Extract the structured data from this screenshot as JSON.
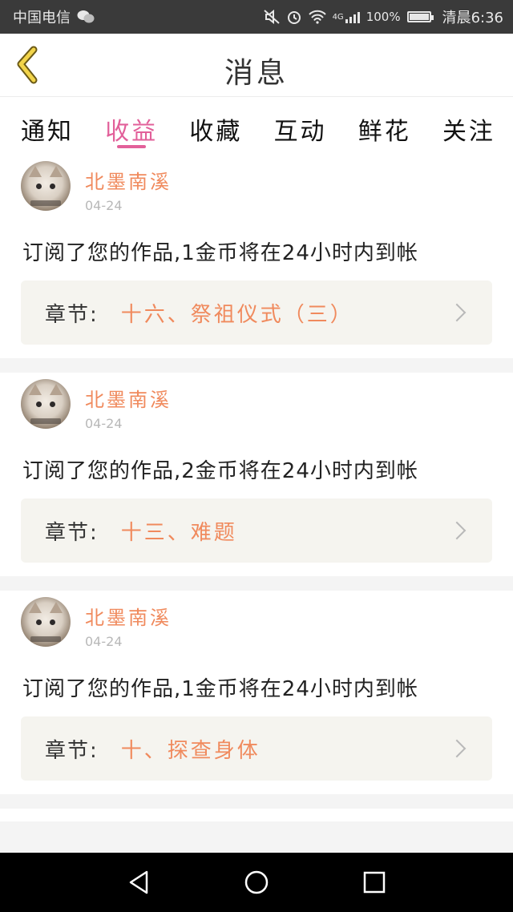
{
  "status_bar": {
    "carrier": "中国电信",
    "network": "4G",
    "battery": "100%",
    "time": "清晨6:36"
  },
  "header": {
    "title": "消息"
  },
  "tabs": [
    {
      "label": "通知",
      "active": false
    },
    {
      "label": "收益",
      "active": true
    },
    {
      "label": "收藏",
      "active": false
    },
    {
      "label": "互动",
      "active": false
    },
    {
      "label": "鲜花",
      "active": false
    },
    {
      "label": "关注",
      "active": false
    }
  ],
  "messages": [
    {
      "user": "北墨南溪",
      "date": "04-24",
      "text": "订阅了您的作品,1金币将在24小时内到帐",
      "chapter_label": "章节:",
      "chapter_title": "十六、祭祖仪式（三）"
    },
    {
      "user": "北墨南溪",
      "date": "04-24",
      "text": "订阅了您的作品,2金币将在24小时内到帐",
      "chapter_label": "章节:",
      "chapter_title": "十三、难题"
    },
    {
      "user": "北墨南溪",
      "date": "04-24",
      "text": "订阅了您的作品,1金币将在24小时内到帐",
      "chapter_label": "章节:",
      "chapter_title": "十、探查身体"
    }
  ],
  "colors": {
    "accent_pink": "#e2609a",
    "accent_orange": "#f08a5d"
  }
}
